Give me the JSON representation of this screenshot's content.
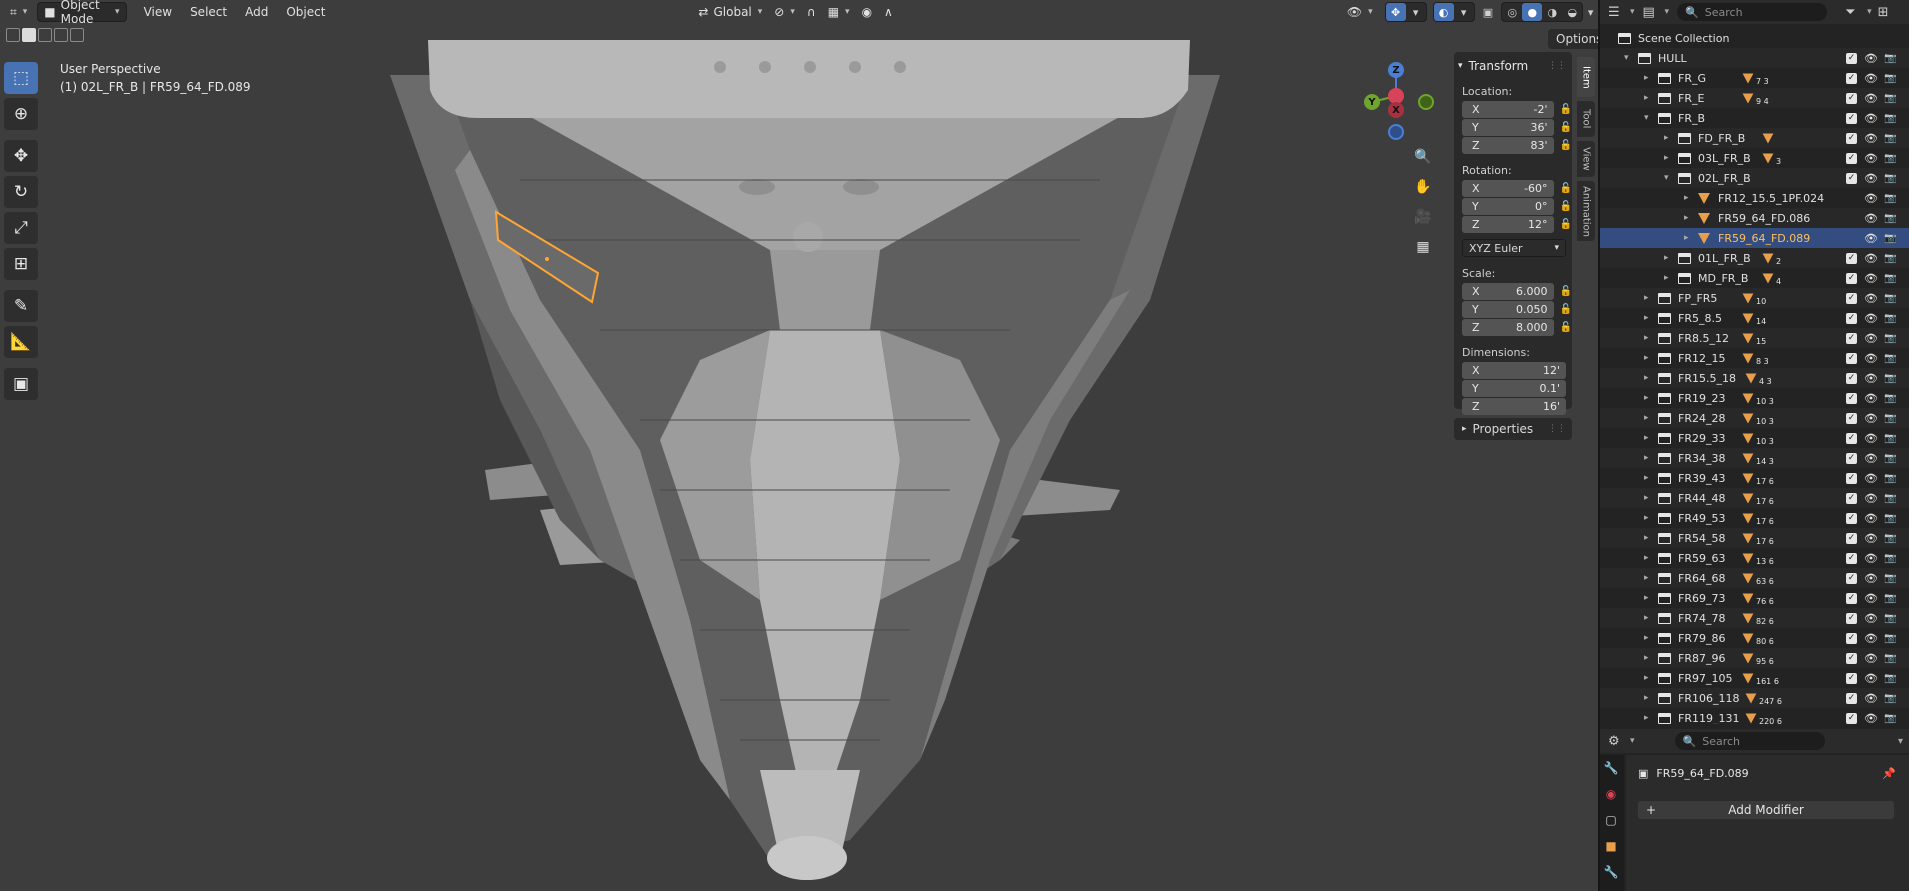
{
  "viewport": {
    "header": {
      "editor_icon": "3d-viewport-icon",
      "mode": "Object Mode",
      "menus": [
        "View",
        "Select",
        "Add",
        "Object"
      ],
      "orientation": "Global",
      "options": "Options"
    },
    "overlay_text": {
      "perspective": "User Perspective",
      "active": "(1) 02L_FR_B | FR59_64_FD.089"
    },
    "tools": [
      "select-box-icon",
      "cursor-icon",
      "move-icon",
      "rotate-icon",
      "scale-icon",
      "transform-icon",
      "annotate-icon",
      "measure-icon",
      "add-cube-icon"
    ],
    "gizmo": {
      "z": "Z",
      "y": "Y",
      "x": "X"
    }
  },
  "npanel": {
    "transform_title": "Transform",
    "location_label": "Location:",
    "location": [
      {
        "axis": "X",
        "value": "-2'"
      },
      {
        "axis": "Y",
        "value": "36'"
      },
      {
        "axis": "Z",
        "value": "83'"
      }
    ],
    "rotation_label": "Rotation:",
    "rotation": [
      {
        "axis": "X",
        "value": "-60°"
      },
      {
        "axis": "Y",
        "value": "0°"
      },
      {
        "axis": "Z",
        "value": "12°"
      }
    ],
    "rotation_mode": "XYZ Euler",
    "scale_label": "Scale:",
    "scale": [
      {
        "axis": "X",
        "value": "6.000"
      },
      {
        "axis": "Y",
        "value": "0.050"
      },
      {
        "axis": "Z",
        "value": "8.000"
      }
    ],
    "dimensions_label": "Dimensions:",
    "dimensions": [
      {
        "axis": "X",
        "value": "12'"
      },
      {
        "axis": "Y",
        "value": "0.1'"
      },
      {
        "axis": "Z",
        "value": "16'"
      }
    ],
    "properties_title": "Properties",
    "tabs": [
      "Item",
      "Tool",
      "View",
      "Animation"
    ]
  },
  "outliner": {
    "search_placeholder": "Search",
    "rows": [
      {
        "name": "Scene Collection",
        "kind": "scene",
        "depth": 0
      },
      {
        "name": "HULL",
        "kind": "coll",
        "depth": 1,
        "open": true
      },
      {
        "name": "FR_G",
        "kind": "coll",
        "depth": 2,
        "badge": "7 3"
      },
      {
        "name": "FR_E",
        "kind": "coll",
        "depth": 2,
        "badge": "9 4"
      },
      {
        "name": "FR_B",
        "kind": "coll",
        "depth": 2,
        "open": true
      },
      {
        "name": "FD_FR_B",
        "kind": "coll",
        "depth": 3,
        "badge": ""
      },
      {
        "name": "03L_FR_B",
        "kind": "coll",
        "depth": 3,
        "badge": "3"
      },
      {
        "name": "02L_FR_B",
        "kind": "coll",
        "depth": 3,
        "open": true
      },
      {
        "name": "FR12_15.5_1PF.024",
        "kind": "mesh",
        "depth": 4
      },
      {
        "name": "FR59_64_FD.086",
        "kind": "mesh",
        "depth": 4
      },
      {
        "name": "FR59_64_FD.089",
        "kind": "mesh",
        "depth": 4,
        "selected": true
      },
      {
        "name": "01L_FR_B",
        "kind": "coll",
        "depth": 3,
        "badge": "2"
      },
      {
        "name": "MD_FR_B",
        "kind": "coll",
        "depth": 3,
        "badge": "4"
      },
      {
        "name": "FP_FR5",
        "kind": "coll",
        "depth": 2,
        "badge": "10"
      },
      {
        "name": "FR5_8.5",
        "kind": "coll",
        "depth": 2,
        "badge": "14"
      },
      {
        "name": "FR8.5_12",
        "kind": "coll",
        "depth": 2,
        "badge": "15"
      },
      {
        "name": "FR12_15",
        "kind": "coll",
        "depth": 2,
        "badge": "8 3"
      },
      {
        "name": "FR15.5_18",
        "kind": "coll",
        "depth": 2,
        "badge": "4 3"
      },
      {
        "name": "FR19_23",
        "kind": "coll",
        "depth": 2,
        "badge": "10 3"
      },
      {
        "name": "FR24_28",
        "kind": "coll",
        "depth": 2,
        "badge": "10 3"
      },
      {
        "name": "FR29_33",
        "kind": "coll",
        "depth": 2,
        "badge": "10 3"
      },
      {
        "name": "FR34_38",
        "kind": "coll",
        "depth": 2,
        "badge": "14 3"
      },
      {
        "name": "FR39_43",
        "kind": "coll",
        "depth": 2,
        "badge": "17 6"
      },
      {
        "name": "FR44_48",
        "kind": "coll",
        "depth": 2,
        "badge": "17 6"
      },
      {
        "name": "FR49_53",
        "kind": "coll",
        "depth": 2,
        "badge": "17 6"
      },
      {
        "name": "FR54_58",
        "kind": "coll",
        "depth": 2,
        "badge": "17 6"
      },
      {
        "name": "FR59_63",
        "kind": "coll",
        "depth": 2,
        "badge": "13 6"
      },
      {
        "name": "FR64_68",
        "kind": "coll",
        "depth": 2,
        "badge": "63 6"
      },
      {
        "name": "FR69_73",
        "kind": "coll",
        "depth": 2,
        "badge": "76 6"
      },
      {
        "name": "FR74_78",
        "kind": "coll",
        "depth": 2,
        "badge": "82 6"
      },
      {
        "name": "FR79_86",
        "kind": "coll",
        "depth": 2,
        "badge": "80 6"
      },
      {
        "name": "FR87_96",
        "kind": "coll",
        "depth": 2,
        "badge": "95 6"
      },
      {
        "name": "FR97_105",
        "kind": "coll",
        "depth": 2,
        "badge": "161 6"
      },
      {
        "name": "FR106_118",
        "kind": "coll",
        "depth": 2,
        "badge": "247 6"
      },
      {
        "name": "FR119_131",
        "kind": "coll",
        "depth": 2,
        "badge": "220 6"
      }
    ]
  },
  "properties": {
    "search_placeholder": "Search",
    "object_name": "FR59_64_FD.089",
    "add_modifier": "Add Modifier"
  },
  "colors": {
    "accent": "#4772b3",
    "selection": "#ffa533",
    "mesh_icon": "#e89e4b"
  }
}
